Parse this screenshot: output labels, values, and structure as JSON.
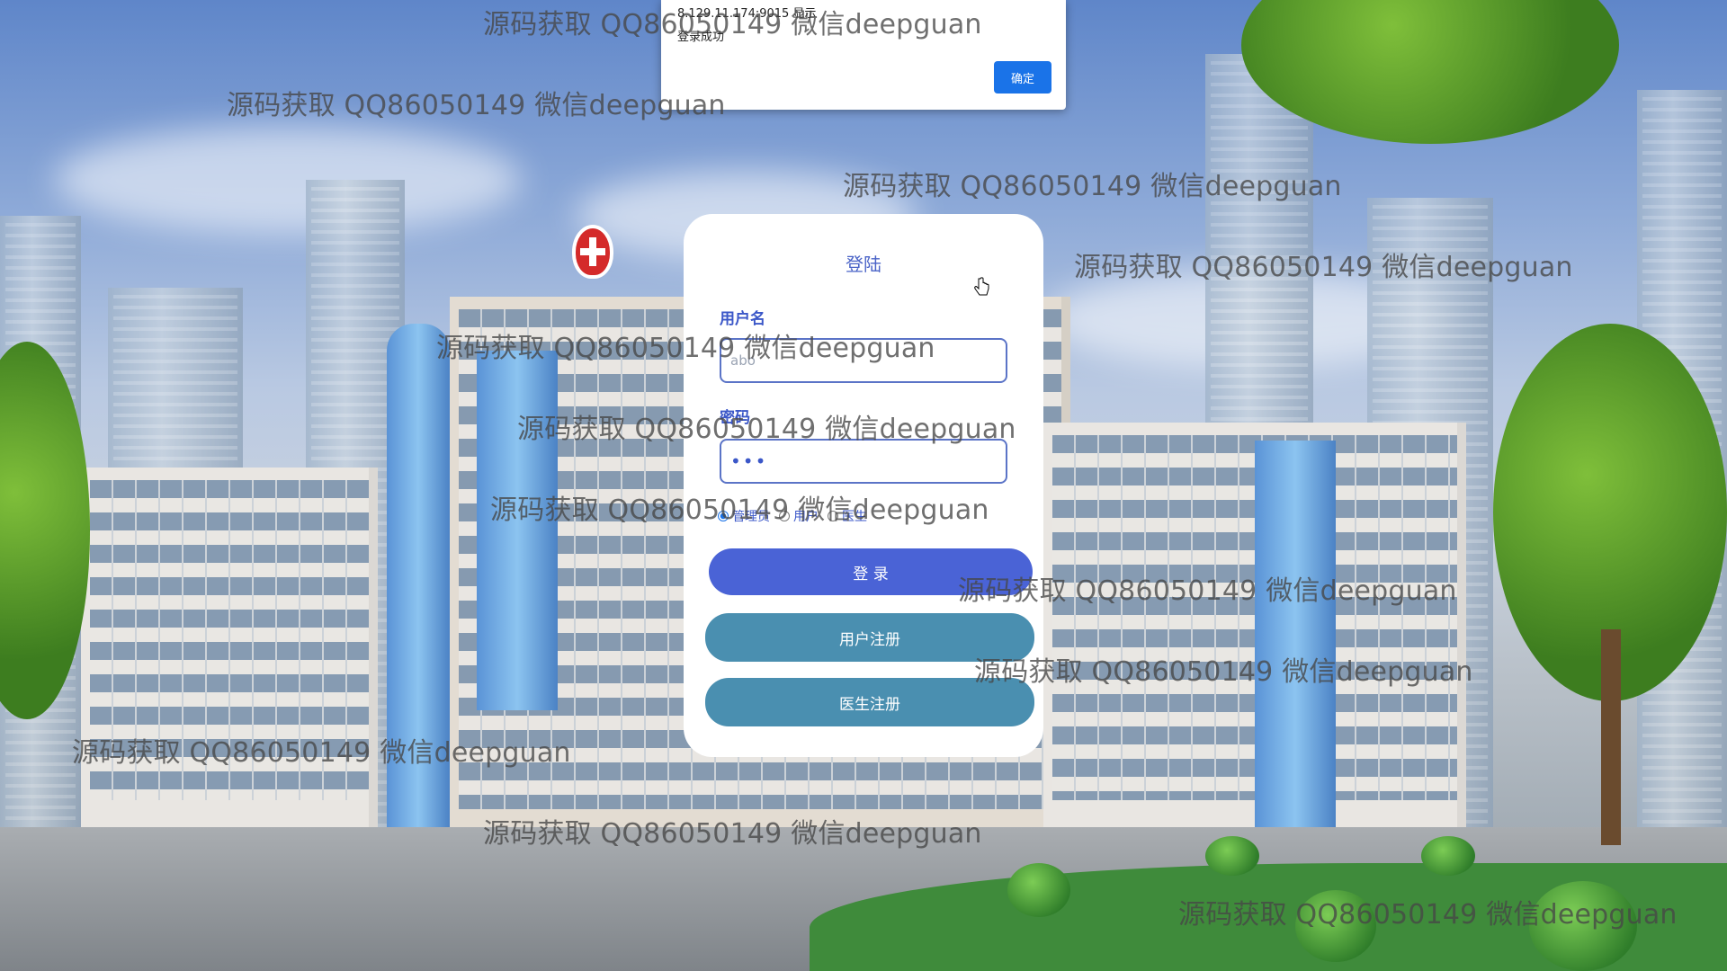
{
  "watermark": {
    "text": "源码获取 QQ86050149 微信deepguan",
    "placements": 11
  },
  "alert": {
    "origin": "8.129.11.174:9015 显示",
    "message": "登录成功",
    "ok_label": "确定"
  },
  "login": {
    "title": "登陆",
    "username_label": "用户名",
    "username_value": "abo",
    "password_label": "密码",
    "password_value": "•••",
    "roles": [
      {
        "label": "管理员",
        "selected": true
      },
      {
        "label": "用户",
        "selected": false
      },
      {
        "label": "医生",
        "selected": false
      }
    ],
    "login_button": "登 录",
    "user_register_button": "用户注册",
    "doctor_register_button": "医生注册"
  },
  "colors": {
    "accent": "#4a63d6",
    "secondary": "#4a8fb0",
    "dialog_button": "#1a73e8"
  }
}
